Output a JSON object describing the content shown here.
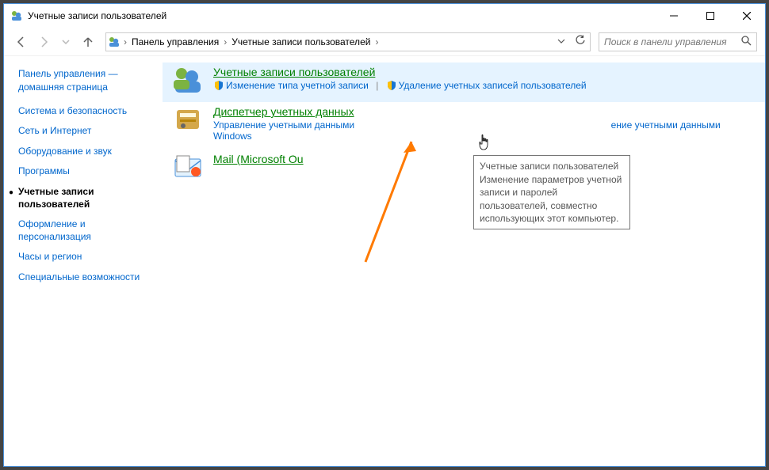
{
  "window": {
    "title": "Учетные записи пользователей"
  },
  "breadcrumb": {
    "root_sep": "›",
    "item1": "Панель управления",
    "item2": "Учетные записи пользователей",
    "tail_sep": "›"
  },
  "search": {
    "placeholder": "Поиск в панели управления"
  },
  "sidebar": {
    "home": "Панель управления — домашняя страница",
    "items": [
      {
        "label": "Система и безопасность",
        "active": false
      },
      {
        "label": "Сеть и Интернет",
        "active": false
      },
      {
        "label": "Оборудование и звук",
        "active": false
      },
      {
        "label": "Программы",
        "active": false
      },
      {
        "label": "Учетные записи пользователей",
        "active": true
      },
      {
        "label": "Оформление и персонализация",
        "active": false
      },
      {
        "label": "Часы и регион",
        "active": false
      },
      {
        "label": "Специальные возможности",
        "active": false
      }
    ]
  },
  "main": {
    "user_accounts": {
      "title": "Учетные записи пользователей",
      "link1": "Изменение типа учетной записи",
      "link2": "Удаление учетных записей пользователей"
    },
    "credential_manager": {
      "title": "Диспетчер учетных данных",
      "link1_pre": "Управление учетными данными ",
      "link1_post": "ение учетными данными Windows"
    },
    "mail": {
      "title": "Mail (Microsoft Ou"
    }
  },
  "tooltip": {
    "title": "Учетные записи пользователей",
    "body": "Изменение параметров учетной записи и паролей пользователей, совместно использующих этот компьютер."
  }
}
